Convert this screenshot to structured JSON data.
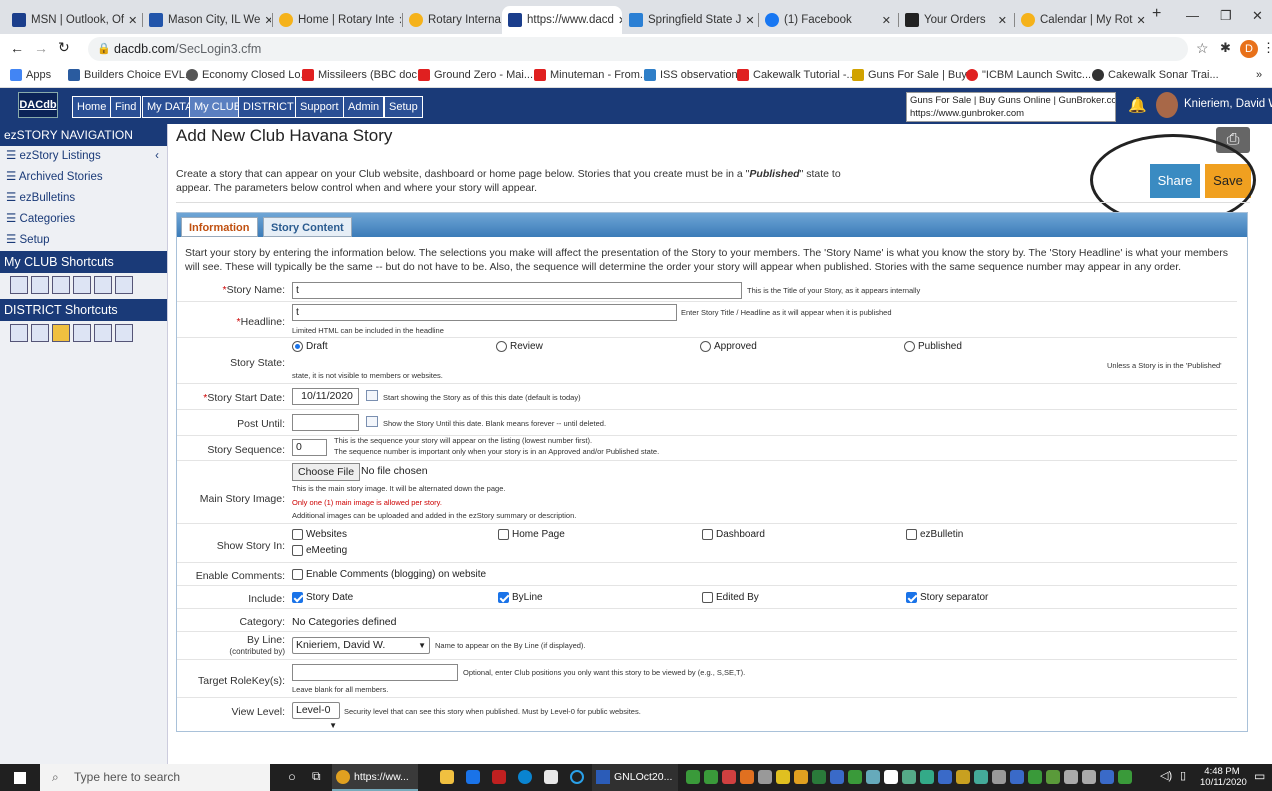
{
  "tabs": [
    {
      "label": "MSN | Outlook, Of",
      "color": "#1b3e8c"
    },
    {
      "label": "Mason City, IL We",
      "color": "#2255aa"
    },
    {
      "label": "Home | Rotary Inte",
      "color": "#f5b21a"
    },
    {
      "label": "Rotary Internation",
      "color": "#f5b21a"
    },
    {
      "label": "https://www.dacd",
      "color": "#1b3e8c",
      "active": true
    },
    {
      "label": "Springfield State J",
      "color": "#2a7fd4"
    },
    {
      "label": "(1) Facebook",
      "color": "#1877f2"
    },
    {
      "label": "Your Orders",
      "color": "#222"
    },
    {
      "label": "Calendar | My Rot",
      "color": "#f5b21a"
    }
  ],
  "url": {
    "domain": "dacdb.com",
    "path": "/SecLogin3.cfm"
  },
  "bookmarks": [
    "Apps",
    "Builders Choice EVL...",
    "Economy Closed Lo...",
    "Missileers (BBC doc...",
    "Ground Zero - Mai...",
    "Minuteman - From...",
    "ISS observation",
    "Cakewalk Tutorial -...",
    "Guns For Sale | Buy...",
    "\"ICBM Launch Switc...",
    "Cakewalk Sonar Trai...",
    "»"
  ],
  "tooltip": {
    "title": "Guns For Sale | Buy Guns Online | GunBroker.com",
    "url": "https://www.gunbroker.com"
  },
  "site": {
    "logo": "DACdb",
    "nav": [
      "Home",
      "Find",
      "My DATA",
      "My CLUB",
      "DISTRICT",
      "Support",
      "Admin",
      "Setup"
    ],
    "active_nav": "My CLUB",
    "user": "Knieriem, David W."
  },
  "sidebar": {
    "heading": "ezSTORY NAVIGATION",
    "items": [
      "ezStory Listings",
      "Archived Stories",
      "ezBulletins",
      "Categories",
      "Setup"
    ],
    "club_shortcuts": "My CLUB Shortcuts",
    "district_shortcuts": "DISTRICT Shortcuts"
  },
  "page": {
    "title": "Add New Club Havana Story",
    "intro_a": "Create a story that can appear on your Club website, dashboard or home page below. Stories that you create must be in a \"",
    "intro_em": "Published",
    "intro_b": "\" state to appear. The parameters below control when and where your story will appear.",
    "share": "Share",
    "save": "Save"
  },
  "panel_tabs": [
    "Information",
    "Story Content"
  ],
  "form": {
    "intro": "Start your story by entering the information below. The selections you make will affect the presentation of the Story to your members. The 'Story Name' is what you know the story by. The 'Story Headline' is what your members will see. These will typically be the same -- but do not have to be. Also, the sequence will determine the order your story will appear when published. Stories with the same sequence number may appear in any order.",
    "story_name_label": "Story Name:",
    "story_name_value": "t",
    "story_name_hint": "This is the Title of your Story, as it appears internally",
    "headline_label": "Headline:",
    "headline_value": "t",
    "headline_hint": "Enter Story Title / Headline as it will appear when it is published",
    "headline_note": "Limited HTML can be included in the headline",
    "state_label": "Story State:",
    "states": [
      "Draft",
      "Review",
      "Approved",
      "Published"
    ],
    "state_selected": "Draft",
    "state_note_a": "Unless a Story is in the 'Published'",
    "state_note_b": "state, it is not visible to members or websites.",
    "start_label": "Story Start Date:",
    "start_value": "10/11/2020",
    "start_hint": "Start showing the Story as of this this date (default is today)",
    "post_label": "Post Until:",
    "post_value": "",
    "post_hint": "Show the Story Until this date. Blank means forever -- until deleted.",
    "seq_label": "Story Sequence:",
    "seq_value": "0",
    "seq_hint1": "This is the sequence your story will appear on the listing (lowest number first).",
    "seq_hint2": "The sequence number is important only when your story is in an Approved and/or Published state.",
    "img_label": "Main Story Image:",
    "choose_file": "Choose File",
    "no_file": "No file chosen",
    "img_hint1": "This is the main story image. It will be alternated down the page.",
    "img_hint2": "Only one (1) main image is allowed per story.",
    "img_hint3": "Additional images can be uploaded and added in the ezStory summary or description.",
    "show_label": "Show Story In:",
    "show_opts": [
      "Websites",
      "Home Page",
      "Dashboard",
      "ezBulletin",
      "eMeeting"
    ],
    "comments_label": "Enable Comments:",
    "comments_opt": "Enable Comments (blogging) on website",
    "include_label": "Include:",
    "include_opts": [
      "Story Date",
      "ByLine",
      "Edited By",
      "Story separator"
    ],
    "category_label": "Category:",
    "category_value": "No Categories defined",
    "byline_label": "By Line:",
    "byline_sub": "(contributed by)",
    "byline_value": "Knieriem, David W.",
    "byline_hint": "Name to appear on the By Line (if displayed).",
    "role_label": "Target RoleKey(s):",
    "role_hint": "Optional, enter Club positions you only want this story to be viewed by (e.g., S,SE,T).",
    "role_note": "Leave blank for all members.",
    "view_label": "View Level:",
    "view_value": "Level-0",
    "view_hint": "Security level that can see this story when published. Must by Level-0 for public websites."
  },
  "taskbar": {
    "search": "Type here to search",
    "chrome": "https://ww...",
    "word": "GNLOct20...",
    "time": "4:48 PM",
    "date": "10/11/2020"
  }
}
